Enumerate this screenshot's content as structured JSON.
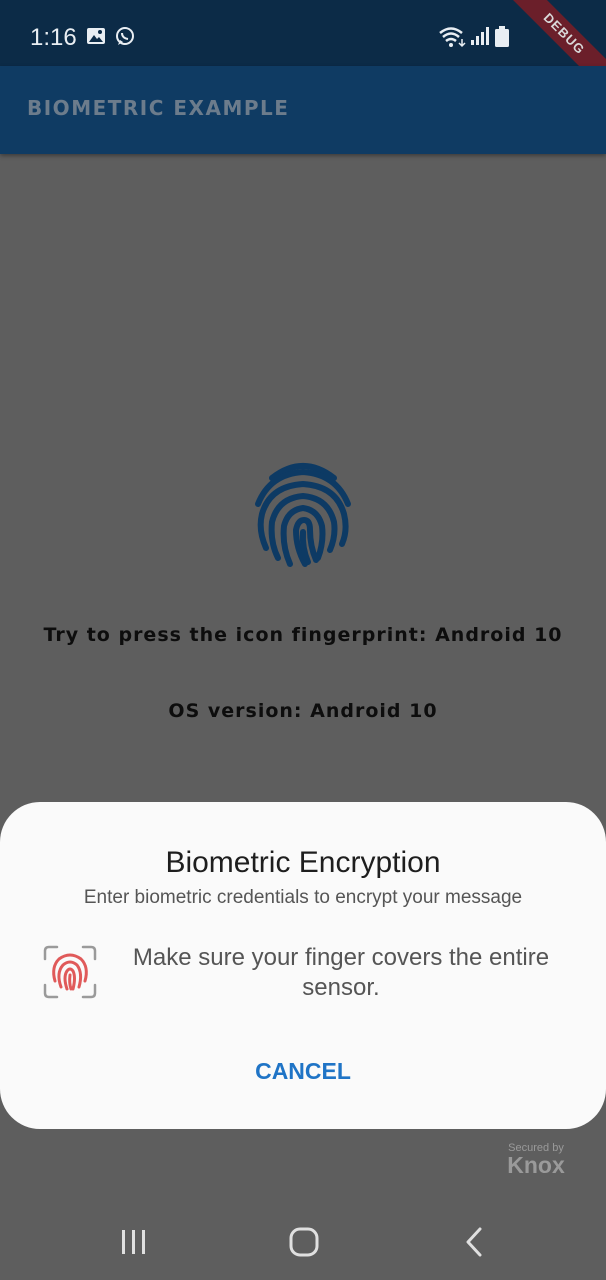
{
  "status_bar": {
    "time": "1:16",
    "icons": [
      "image-icon",
      "whatsapp-icon",
      "wifi-icon",
      "signal-icon",
      "battery-icon"
    ]
  },
  "debug_banner": "DEBUG",
  "app_bar": {
    "title": "BIOMETRIC EXAMPLE"
  },
  "main": {
    "icon": "fingerprint-icon",
    "prompt_text": "Try to press the icon fingerprint: Android 10",
    "os_version_text": "OS version: Android 10"
  },
  "dialog": {
    "title": "Biometric Encryption",
    "subtitle": "Enter biometric credentials to encrypt your message",
    "icon": "fingerprint-sensor-icon",
    "message": "Make sure your finger covers the entire sensor.",
    "cancel_label": "CANCEL"
  },
  "knox": {
    "secured_by": "Secured by",
    "logo": "Knox"
  },
  "nav_bar": {
    "icons": [
      "recent-apps-icon",
      "home-icon",
      "back-icon"
    ]
  },
  "colors": {
    "app_bar": "#0f3b63",
    "status_bar": "#0c2b47",
    "scrim_background": "#5e5e5e",
    "accent": "#1f74c6",
    "fingerprint": "#0d3a64",
    "sensor_red": "#e05a5a"
  }
}
